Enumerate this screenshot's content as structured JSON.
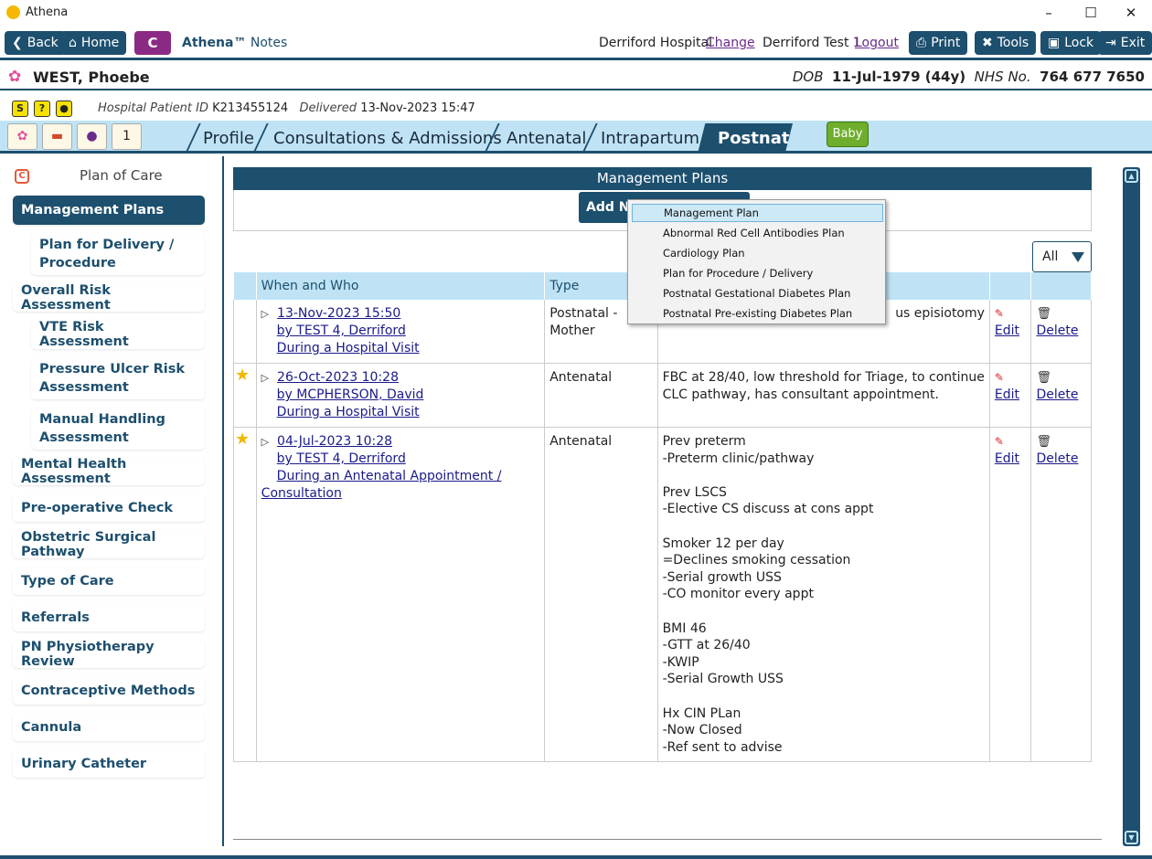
{
  "window": {
    "title": "Athena"
  },
  "toolbar": {
    "back": "Back",
    "home": "Home",
    "c_label": "C",
    "app_name": "Athena™",
    "app_sub": "Notes",
    "hospital": "Derriford Hospital",
    "change": "Change",
    "user": "Derriford Test 1",
    "logout": "Logout",
    "print": "Print",
    "tools": "Tools",
    "lock": "Lock",
    "exit": "Exit"
  },
  "patient": {
    "name": "WEST, Phoebe",
    "dob_label": "DOB",
    "dob": "11-Jul-1979 (44y)",
    "nhs_label": "NHS No.",
    "nhs": "764 677 7650",
    "hpid_label": "Hospital Patient ID",
    "hpid": "K213455124",
    "delivered_label": "Delivered",
    "delivered": "13-Nov-2023 15:47"
  },
  "tabs": [
    "Profile",
    "Consultations & Admissions",
    "Antenatal",
    "Intrapartum",
    "Postnatal"
  ],
  "active_tab": "Postnatal",
  "baby": "Baby",
  "sidebar": {
    "header": "Plan of Care",
    "items": [
      "Management Plans",
      "Plan for Delivery / Procedure",
      "Overall Risk Assessment",
      "VTE Risk Assessment",
      "Pressure Ulcer Risk Assessment",
      "Manual Handling Assessment",
      "Mental Health Assessment",
      "Pre-operative Check",
      "Obstetric Surgical Pathway",
      "Type of Care",
      "Referrals",
      "PN Physiotherapy Review",
      "Contraceptive Methods",
      "Cannula",
      "Urinary Catheter"
    ]
  },
  "main": {
    "title": "Management Plans",
    "add_new": "Add New",
    "filter": "All",
    "columns": [
      "When and Who",
      "Type",
      "",
      ""
    ],
    "rows": [
      {
        "date": "13-Nov-2023 15:50",
        "by": "by TEST 4, Derriford",
        "ctx": "During a Hospital Visit",
        "type": "Postnatal - Mother",
        "notes": "us episiotomy",
        "starred": false
      },
      {
        "date": "26-Oct-2023 10:28",
        "by": "by MCPHERSON, David",
        "ctx": "During a Hospital Visit",
        "type": "Antenatal",
        "notes": "FBC at 28/40, low threshold for Triage, to continue\nCLC pathway, has consultant appointment.",
        "starred": true
      },
      {
        "date": "04-Jul-2023 10:28",
        "by": "by TEST 4, Derriford",
        "ctx": "During an Antenatal Appointment / Consultation",
        "type": "Antenatal",
        "notes": "Prev preterm\n-Preterm clinic/pathway\n\nPrev LSCS\n-Elective CS discuss at cons appt\n\nSmoker 12 per day\n=Declines smoking cessation\n-Serial growth USS\n-CO monitor every appt\n\nBMI 46\n-GTT at 26/40\n-KWIP\n-Serial Growth USS\n\nHx CIN PLan\n-Now Closed\n-Ref sent to advise",
        "starred": true
      }
    ],
    "edit": "Edit",
    "delete": "Delete"
  },
  "menu": {
    "items": [
      "Management Plan",
      "Abnormal Red Cell Antibodies Plan",
      "Cardiology Plan",
      "Plan for Procedure / Delivery",
      "Postnatal Gestational Diabetes Plan",
      "Postnatal Pre-existing Diabetes Plan"
    ],
    "highlighted": "Management Plan"
  },
  "icons": {
    "flower": "flower-icon",
    "star": "star-icon",
    "pencil": "pencil-icon",
    "trash": "trash-icon"
  },
  "colors": {
    "primary": "#1d4f6e",
    "tabstrip": "#bfe3f5",
    "c_button": "#8b2a84",
    "baby": "#6fae2c",
    "star": "#f0b800"
  }
}
